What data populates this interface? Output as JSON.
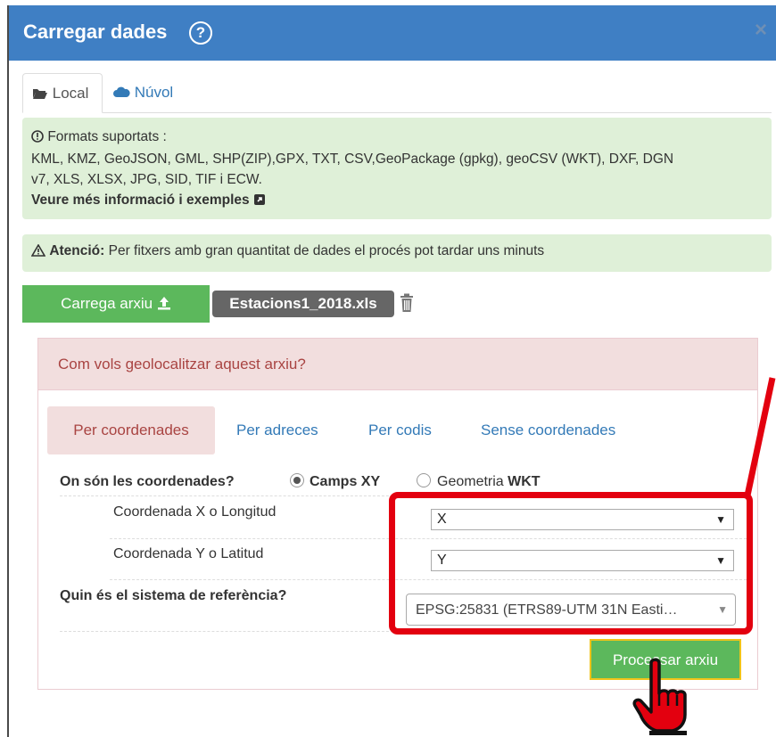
{
  "dialog": {
    "title": "Carregar dades",
    "help_icon": "question-circle-icon",
    "close_icon": "close-icon",
    "close_glyph": "×"
  },
  "tabs": [
    {
      "label": "Local",
      "icon": "folder-open-icon"
    },
    {
      "label": "Núvol",
      "icon": "cloud-icon"
    }
  ],
  "formats": {
    "heading": "Formats suportats :",
    "list_line1": "KML, KMZ, GeoJSON, GML, SHP(ZIP),GPX, TXT, CSV,GeoPackage (gpkg), geoCSV (WKT), DXF, DGN",
    "list_line2": "v7, XLS, XLSX, JPG, SID, TIF i ECW.",
    "more_link": "Veure més informació i exemples"
  },
  "attention": {
    "label": "Atenció:",
    "text": "Per fitxers amb gran quantitat de dades el procés pot tardar uns minuts"
  },
  "upload": {
    "button_label": "Carrega arxiu",
    "file_name": "Estacions1_2018.xls"
  },
  "geolocate": {
    "heading": "Com vols geolocalitzar aquest arxiu?",
    "tabs": [
      "Per coordenades",
      "Per adreces",
      "Per codis",
      "Sense coordenades"
    ],
    "where_label": "On són les coordenades?",
    "option_xy": "Camps XY",
    "option_wkt_prefix": "Geometria ",
    "option_wkt_bold": "WKT",
    "x_label": "Coordenada X o Longitud",
    "x_value": "X",
    "y_label": "Coordenada Y o Latitud",
    "y_value": "Y",
    "srs_label": "Quin és el sistema de referència?",
    "srs_value": "EPSG:25831 (ETRS89-UTM 31N Easti…",
    "process_button": "Processar arxiu"
  },
  "colors": {
    "header_blue": "#3f7fc4",
    "success_green": "#5cb85c",
    "highlight_red": "#e3000f"
  }
}
